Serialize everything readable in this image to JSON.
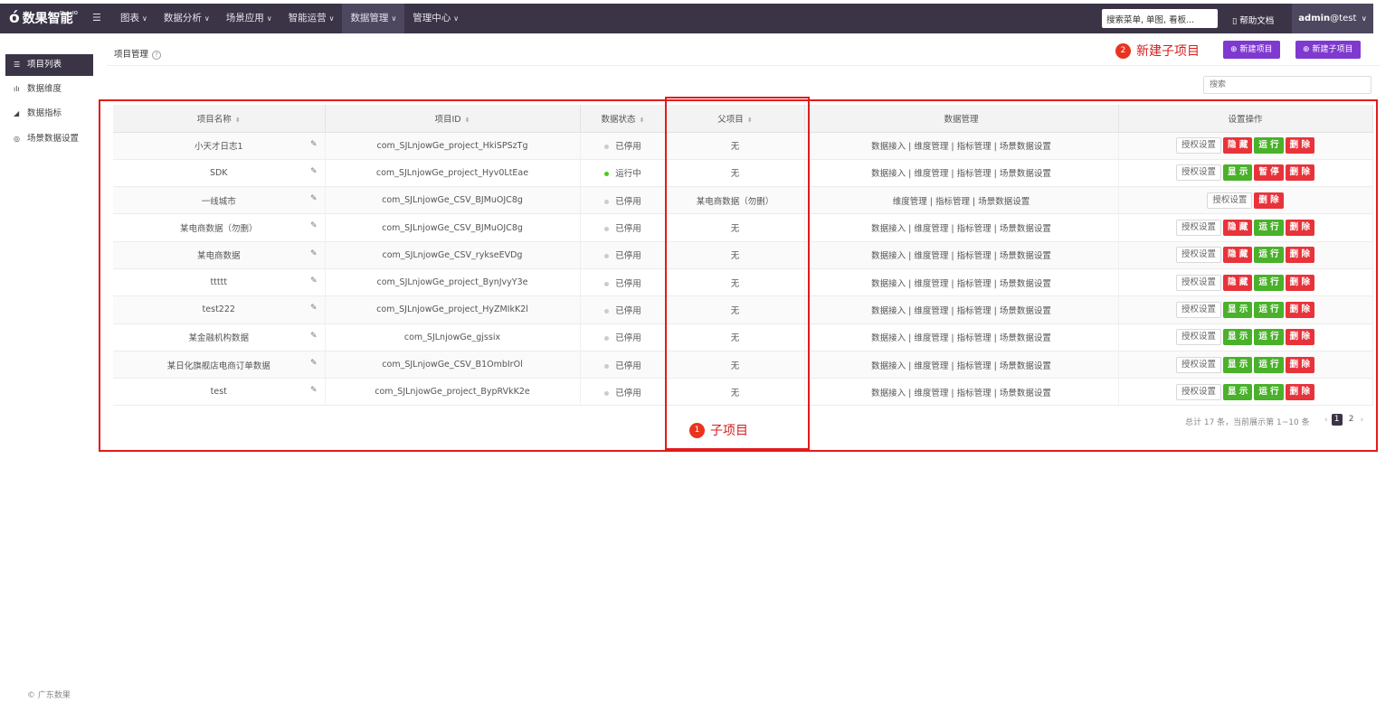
{
  "topbar": {
    "logo_text": "数果智能",
    "logo_sup": "SugoIO",
    "nav": [
      {
        "label": "图表",
        "active": false
      },
      {
        "label": "数据分析",
        "active": false
      },
      {
        "label": "场景应用",
        "active": false
      },
      {
        "label": "智能运营",
        "active": false
      },
      {
        "label": "数据管理",
        "active": true
      },
      {
        "label": "管理中心",
        "active": false
      }
    ],
    "search_value": "搜索菜单, 单图, 看板...",
    "help_label": "帮助文档",
    "user_bold": "admin",
    "user_light": "@test"
  },
  "sidebar": {
    "items": [
      {
        "icon": "☰",
        "label": "项目列表",
        "active": true
      },
      {
        "icon": "ılı",
        "label": "数据维度",
        "active": false
      },
      {
        "icon": "◢",
        "label": "数据指标",
        "active": false
      },
      {
        "icon": "◎",
        "label": "场景数据设置",
        "active": false
      }
    ],
    "copyright": "© 广东数果"
  },
  "main": {
    "page_title": "项目管理",
    "annotation_1": {
      "num": "1",
      "label": "子项目"
    },
    "annotation_2": {
      "num": "2",
      "label": "新建子项目"
    },
    "new_project_label": "新建项目",
    "new_subproject_label": "新建子项目",
    "search_placeholder": "搜索"
  },
  "table": {
    "headers": [
      "项目名称",
      "项目ID",
      "数据状态",
      "父项目",
      "数据管理",
      "设置操作"
    ],
    "rows": [
      {
        "name": "小天才日志1",
        "id": "com_SJLnjowGe_project_HkiSPSzTg",
        "status": "已停用",
        "running": false,
        "parent": "无",
        "ops": [
          "数据接入",
          "维度管理",
          "指标管理",
          "场景数据设置"
        ],
        "actions": [
          {
            "label": "授权设置",
            "kind": "auth"
          },
          {
            "label": "隐 藏",
            "kind": "red"
          },
          {
            "label": "运 行",
            "kind": "green"
          },
          {
            "label": "删 除",
            "kind": "red"
          }
        ]
      },
      {
        "name": "SDK",
        "id": "com_SJLnjowGe_project_Hyv0LtEae",
        "status": "运行中",
        "running": true,
        "parent": "无",
        "ops": [
          "数据接入",
          "维度管理",
          "指标管理",
          "场景数据设置"
        ],
        "actions": [
          {
            "label": "授权设置",
            "kind": "auth"
          },
          {
            "label": "显 示",
            "kind": "green"
          },
          {
            "label": "暂 停",
            "kind": "red"
          },
          {
            "label": "删 除",
            "kind": "red"
          }
        ]
      },
      {
        "name": "一线城市",
        "id": "com_SJLnjowGe_CSV_BJMuOJC8g",
        "status": "已停用",
        "running": false,
        "parent": "某电商数据（勿删）",
        "ops": [
          "维度管理",
          "指标管理",
          "场景数据设置"
        ],
        "actions": [
          {
            "label": "授权设置",
            "kind": "auth"
          },
          {
            "label": "删 除",
            "kind": "red"
          }
        ]
      },
      {
        "name": "某电商数据（勿删）",
        "id": "com_SJLnjowGe_CSV_BJMuOJC8g",
        "status": "已停用",
        "running": false,
        "parent": "无",
        "ops": [
          "数据接入",
          "维度管理",
          "指标管理",
          "场景数据设置"
        ],
        "actions": [
          {
            "label": "授权设置",
            "kind": "auth"
          },
          {
            "label": "隐 藏",
            "kind": "red"
          },
          {
            "label": "运 行",
            "kind": "green"
          },
          {
            "label": "删 除",
            "kind": "red"
          }
        ]
      },
      {
        "name": "某电商数据",
        "id": "com_SJLnjowGe_CSV_rykseEVDg",
        "status": "已停用",
        "running": false,
        "parent": "无",
        "ops": [
          "数据接入",
          "维度管理",
          "指标管理",
          "场景数据设置"
        ],
        "actions": [
          {
            "label": "授权设置",
            "kind": "auth"
          },
          {
            "label": "隐 藏",
            "kind": "red"
          },
          {
            "label": "运 行",
            "kind": "green"
          },
          {
            "label": "删 除",
            "kind": "red"
          }
        ]
      },
      {
        "name": "ttttt",
        "id": "com_SJLnjowGe_project_BynJvyY3e",
        "status": "已停用",
        "running": false,
        "parent": "无",
        "ops": [
          "数据接入",
          "维度管理",
          "指标管理",
          "场景数据设置"
        ],
        "actions": [
          {
            "label": "授权设置",
            "kind": "auth"
          },
          {
            "label": "隐 藏",
            "kind": "red"
          },
          {
            "label": "运 行",
            "kind": "green"
          },
          {
            "label": "删 除",
            "kind": "red"
          }
        ]
      },
      {
        "name": "test222",
        "id": "com_SJLnjowGe_project_HyZMIkK2l",
        "status": "已停用",
        "running": false,
        "parent": "无",
        "ops": [
          "数据接入",
          "维度管理",
          "指标管理",
          "场景数据设置"
        ],
        "actions": [
          {
            "label": "授权设置",
            "kind": "auth"
          },
          {
            "label": "显 示",
            "kind": "green"
          },
          {
            "label": "运 行",
            "kind": "green"
          },
          {
            "label": "删 除",
            "kind": "red"
          }
        ]
      },
      {
        "name": "某金融机构数据",
        "id": "com_SJLnjowGe_gjssix",
        "status": "已停用",
        "running": false,
        "parent": "无",
        "ops": [
          "数据接入",
          "维度管理",
          "指标管理",
          "场景数据设置"
        ],
        "actions": [
          {
            "label": "授权设置",
            "kind": "auth"
          },
          {
            "label": "显 示",
            "kind": "green"
          },
          {
            "label": "运 行",
            "kind": "green"
          },
          {
            "label": "删 除",
            "kind": "red"
          }
        ]
      },
      {
        "name": "某日化旗舰店电商订单数据",
        "id": "com_SJLnjowGe_CSV_B1OmbIrOl",
        "status": "已停用",
        "running": false,
        "parent": "无",
        "ops": [
          "数据接入",
          "维度管理",
          "指标管理",
          "场景数据设置"
        ],
        "actions": [
          {
            "label": "授权设置",
            "kind": "auth"
          },
          {
            "label": "显 示",
            "kind": "green"
          },
          {
            "label": "运 行",
            "kind": "green"
          },
          {
            "label": "删 除",
            "kind": "red"
          }
        ]
      },
      {
        "name": "test",
        "id": "com_SJLnjowGe_project_BypRVkK2e",
        "status": "已停用",
        "running": false,
        "parent": "无",
        "ops": [
          "数据接入",
          "维度管理",
          "指标管理",
          "场景数据设置"
        ],
        "actions": [
          {
            "label": "授权设置",
            "kind": "auth"
          },
          {
            "label": "显 示",
            "kind": "green"
          },
          {
            "label": "运 行",
            "kind": "green"
          },
          {
            "label": "删 除",
            "kind": "red"
          }
        ]
      }
    ]
  },
  "pagination": {
    "info": "总计 17 条，当前展示第 1~10 条",
    "pages": [
      "1",
      "2"
    ],
    "current": "1"
  }
}
